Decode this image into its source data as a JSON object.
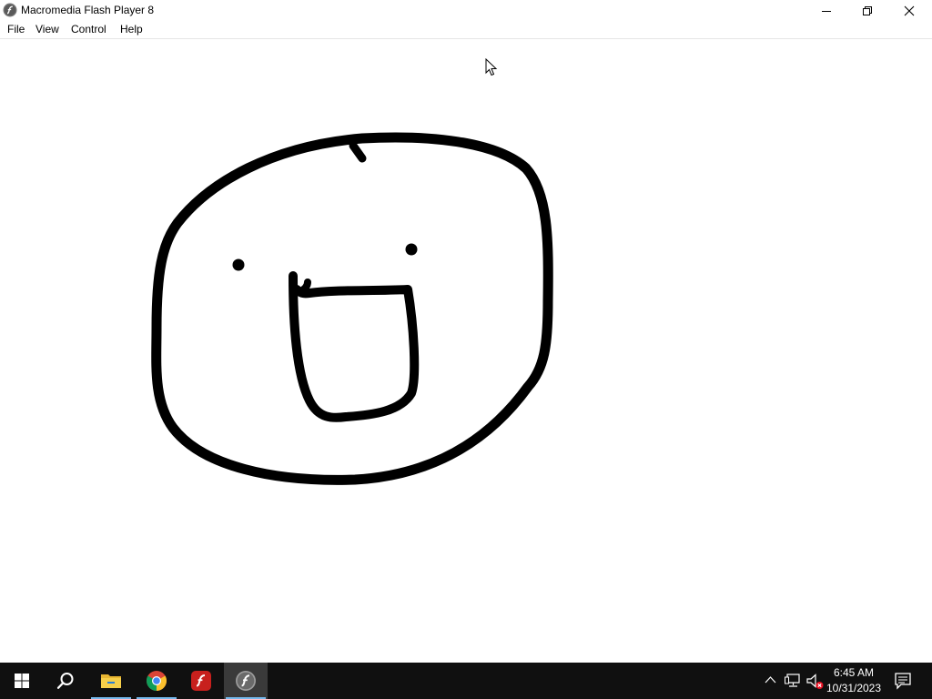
{
  "window": {
    "title": "Macromedia Flash Player 8",
    "app_icon": "flash-player-icon",
    "controls": [
      "minimize-icon",
      "restore-icon",
      "close-icon"
    ]
  },
  "menu": {
    "file": "File",
    "view": "View",
    "control": "Control",
    "help": "Help"
  },
  "stage": {
    "background": "#ffffff",
    "content": "hand-drawn face",
    "stroke_color": "#000000"
  },
  "taskbar": {
    "background": "#101010",
    "items": [
      {
        "icon": "windows-start-icon"
      },
      {
        "icon": "search-icon"
      },
      {
        "icon": "file-explorer-icon"
      },
      {
        "icon": "chrome-icon"
      },
      {
        "icon": "adobe-flash-icon"
      },
      {
        "icon": "flash-player-icon",
        "active": true
      }
    ],
    "tray": [
      "chevron-up-icon",
      "network-icon",
      "volume-muted-icon"
    ],
    "clock": {
      "time": "6:45 AM",
      "date": "10/31/2023"
    },
    "notification_icon": "action-center-icon",
    "accent": "#76b9ed"
  }
}
